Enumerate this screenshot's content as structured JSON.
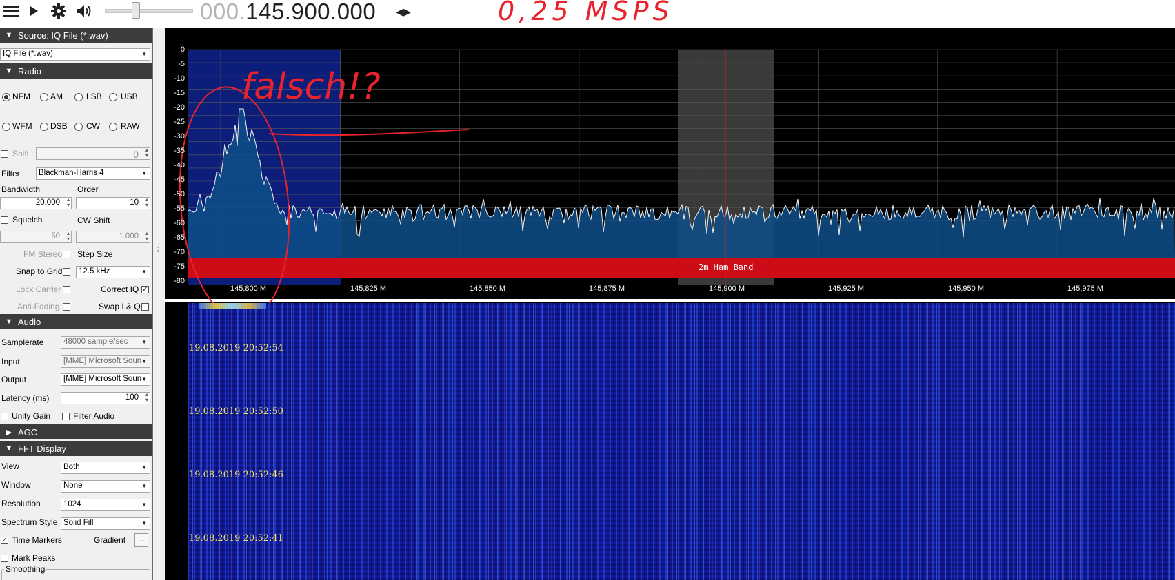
{
  "toolbar": {
    "icons": [
      "menu-icon",
      "play-icon",
      "gear-icon",
      "speaker-icon"
    ],
    "freq_dim": "000.",
    "freq_main": "145.900.000",
    "freq_arrows": "◂▸"
  },
  "annotations": {
    "rate": "0,25 MSPS",
    "falsch": "falsch!?"
  },
  "source": {
    "title": "Source: IQ File (*.wav)",
    "value": "IQ File (*.wav)"
  },
  "radio": {
    "title": "Radio",
    "modes_row1": [
      "NFM",
      "AM",
      "LSB",
      "USB"
    ],
    "modes_row2": [
      "WFM",
      "DSB",
      "CW",
      "RAW"
    ],
    "shift_label": "Shift",
    "shift_value": "0",
    "filter_label": "Filter",
    "filter_value": "Blackman-Harris 4",
    "bandwidth_label": "Bandwidth",
    "bandwidth_value": "20.000",
    "order_label": "Order",
    "order_value": "10",
    "squelch_label": "Squelch",
    "squelch_value": "50",
    "cwshift_label": "CW Shift",
    "cwshift_value": "1.000",
    "fmstereo_label": "FM Stereo",
    "stepsize_label": "Step Size",
    "snap_label": "Snap to Grid",
    "stepsize_value": "12.5 kHz",
    "lockcarrier_label": "Lock Carrier",
    "correctiq_label": "Correct IQ",
    "antifading_label": "Anti-Fading",
    "swapiq_label": "Swap I & Q"
  },
  "audio": {
    "title": "Audio",
    "samplerate_label": "Samplerate",
    "samplerate_value": "48000 sample/sec",
    "input_label": "Input",
    "input_value": "[MME] Microsoft Soun",
    "output_label": "Output",
    "output_value": "[MME] Microsoft Soun",
    "latency_label": "Latency (ms)",
    "latency_value": "100",
    "unity_label": "Unity Gain",
    "filteraudio_label": "Filter Audio"
  },
  "agc": {
    "title": "AGC"
  },
  "fft": {
    "title": "FFT Display",
    "view_label": "View",
    "view_value": "Both",
    "window_label": "Window",
    "window_value": "None",
    "resolution_label": "Resolution",
    "resolution_value": "1024",
    "style_label": "Spectrum Style",
    "style_value": "Solid Fill",
    "timemarkers_label": "Time Markers",
    "gradient_label": "Gradient",
    "gradient_btn": "...",
    "markpeaks_label": "Mark Peaks",
    "smoothing_label": "Smoothing"
  },
  "spectrum": {
    "y_labels": [
      "0",
      "-5",
      "-10",
      "-15",
      "-20",
      "-25",
      "-30",
      "-35",
      "-40",
      "-45",
      "-50",
      "-55",
      "-60",
      "-65",
      "-70",
      "-75",
      "-80"
    ],
    "x_labels": [
      "145,800 M",
      "145,825 M",
      "145,850 M",
      "145,875 M",
      "145,900 M",
      "145,925 M",
      "145,950 M",
      "145,975 M"
    ],
    "band_label": "2m Ham Band",
    "colors": {
      "band": "#cc0d17",
      "passband": "#0d1e7a",
      "fill": "#0f4f88",
      "center": "#e01818"
    }
  },
  "waterfall": {
    "timestamps": [
      "19.08.2019 20:52:54",
      "19.08.2019 20:52:50",
      "19.08.2019 20:52:46",
      "19.08.2019 20:52:41"
    ]
  }
}
